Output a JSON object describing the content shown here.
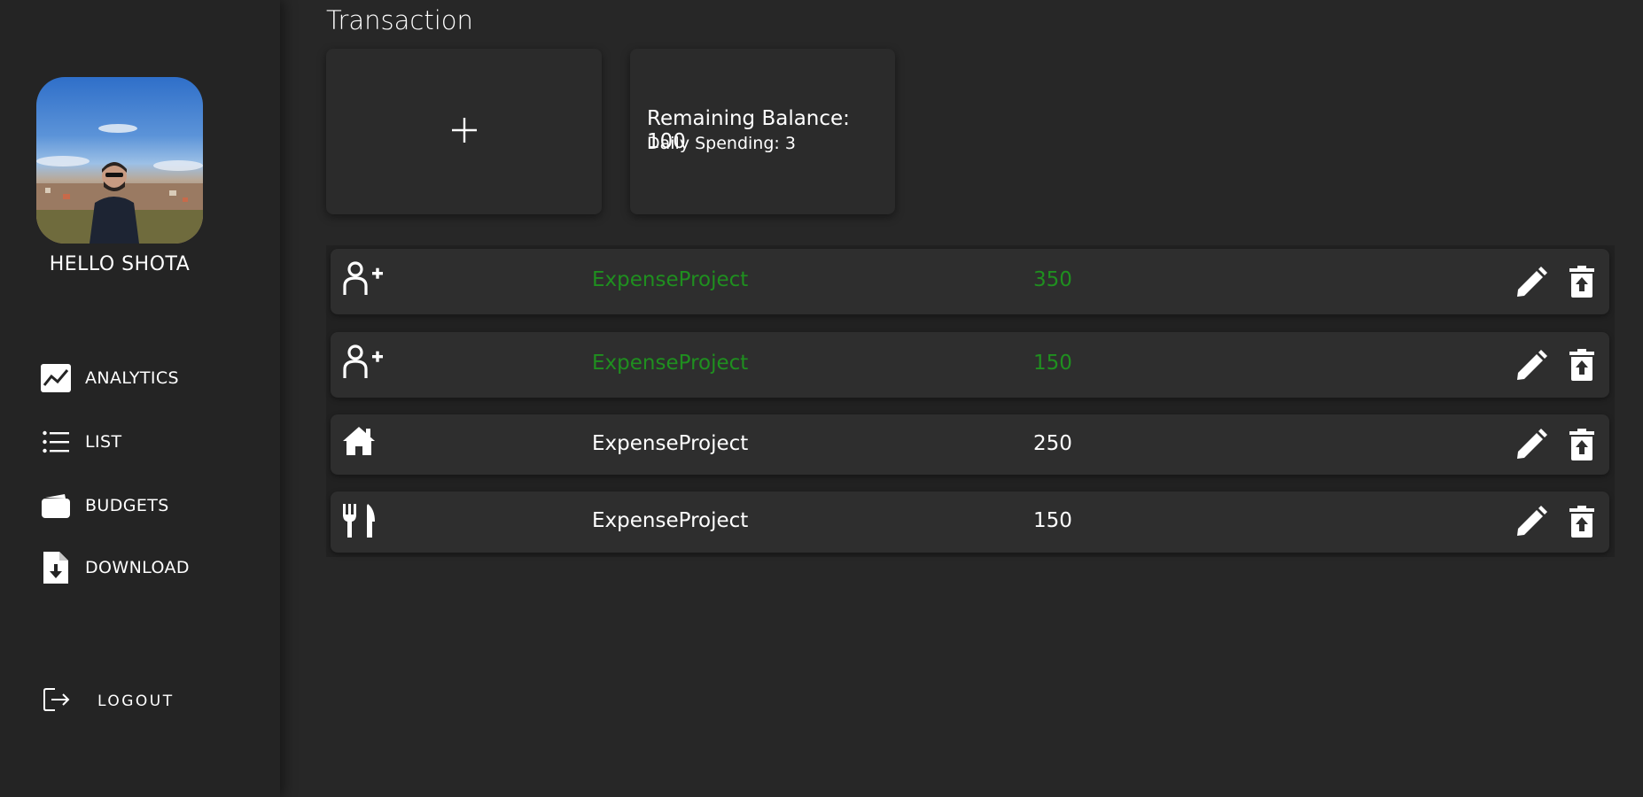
{
  "sidebar": {
    "greeting": "HELLO SHOTA",
    "nav": [
      {
        "label": "ANALYTICS",
        "icon": "chart-icon"
      },
      {
        "label": "LIST",
        "icon": "list-icon"
      },
      {
        "label": "BUDGETS",
        "icon": "wallet-icon"
      },
      {
        "label": "DOWNLOAD",
        "icon": "file-download-icon"
      }
    ],
    "logout_label": "LOGOUT"
  },
  "page": {
    "title": "Transaction"
  },
  "summary": {
    "balance_text": "Remaining Balance: 100",
    "daily_text": "Daily Spending: 3"
  },
  "colors": {
    "income": "#1f8f1f",
    "background": "#272727",
    "sidebar": "#242424"
  },
  "transactions": [
    {
      "category_icon": "add-person-icon",
      "name": "ExpenseProject",
      "amount": "350",
      "type": "income"
    },
    {
      "category_icon": "add-person-icon",
      "name": "ExpenseProject",
      "amount": "150",
      "type": "income"
    },
    {
      "category_icon": "home-icon",
      "name": "ExpenseProject",
      "amount": "250",
      "type": "expense"
    },
    {
      "category_icon": "fork-knife-icon",
      "name": "ExpenseProject",
      "amount": "150",
      "type": "expense"
    }
  ]
}
